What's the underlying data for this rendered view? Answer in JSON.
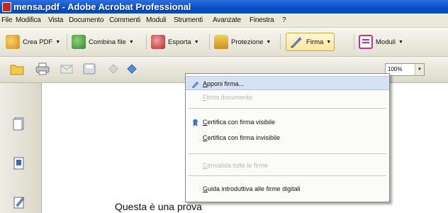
{
  "window": {
    "title": "mensa.pdf - Adobe Acrobat Professional"
  },
  "menubar": {
    "items": [
      "File",
      "Modifica",
      "Vista",
      "Documento",
      "Commenti",
      "Moduli",
      "Strumenti",
      "Avanzate",
      "Finestra",
      "?"
    ]
  },
  "tasks": {
    "crea_pdf": "Crea PDF",
    "combina": "Combina file",
    "esporta": "Esporta",
    "protezione": "Protezione",
    "firma": "Firma",
    "moduli": "Moduli"
  },
  "zoom": {
    "value": "100%"
  },
  "firma_menu": {
    "items": [
      {
        "label": "Apponi firma...",
        "enabled": true,
        "highlighted": true,
        "icon": "pen-icon"
      },
      {
        "label": "Firma documento",
        "enabled": false
      },
      {
        "label": "Certifica con firma visibile",
        "enabled": true,
        "icon": "certificate-ribbon-icon"
      },
      {
        "label": "Certifica con firma invisibile",
        "enabled": true
      },
      {
        "label": "Convalida tutte le firme",
        "enabled": false
      },
      {
        "label": "Guida introduttiva alle firme digitali",
        "enabled": true
      }
    ]
  },
  "document": {
    "text": "Questa è una prova"
  }
}
